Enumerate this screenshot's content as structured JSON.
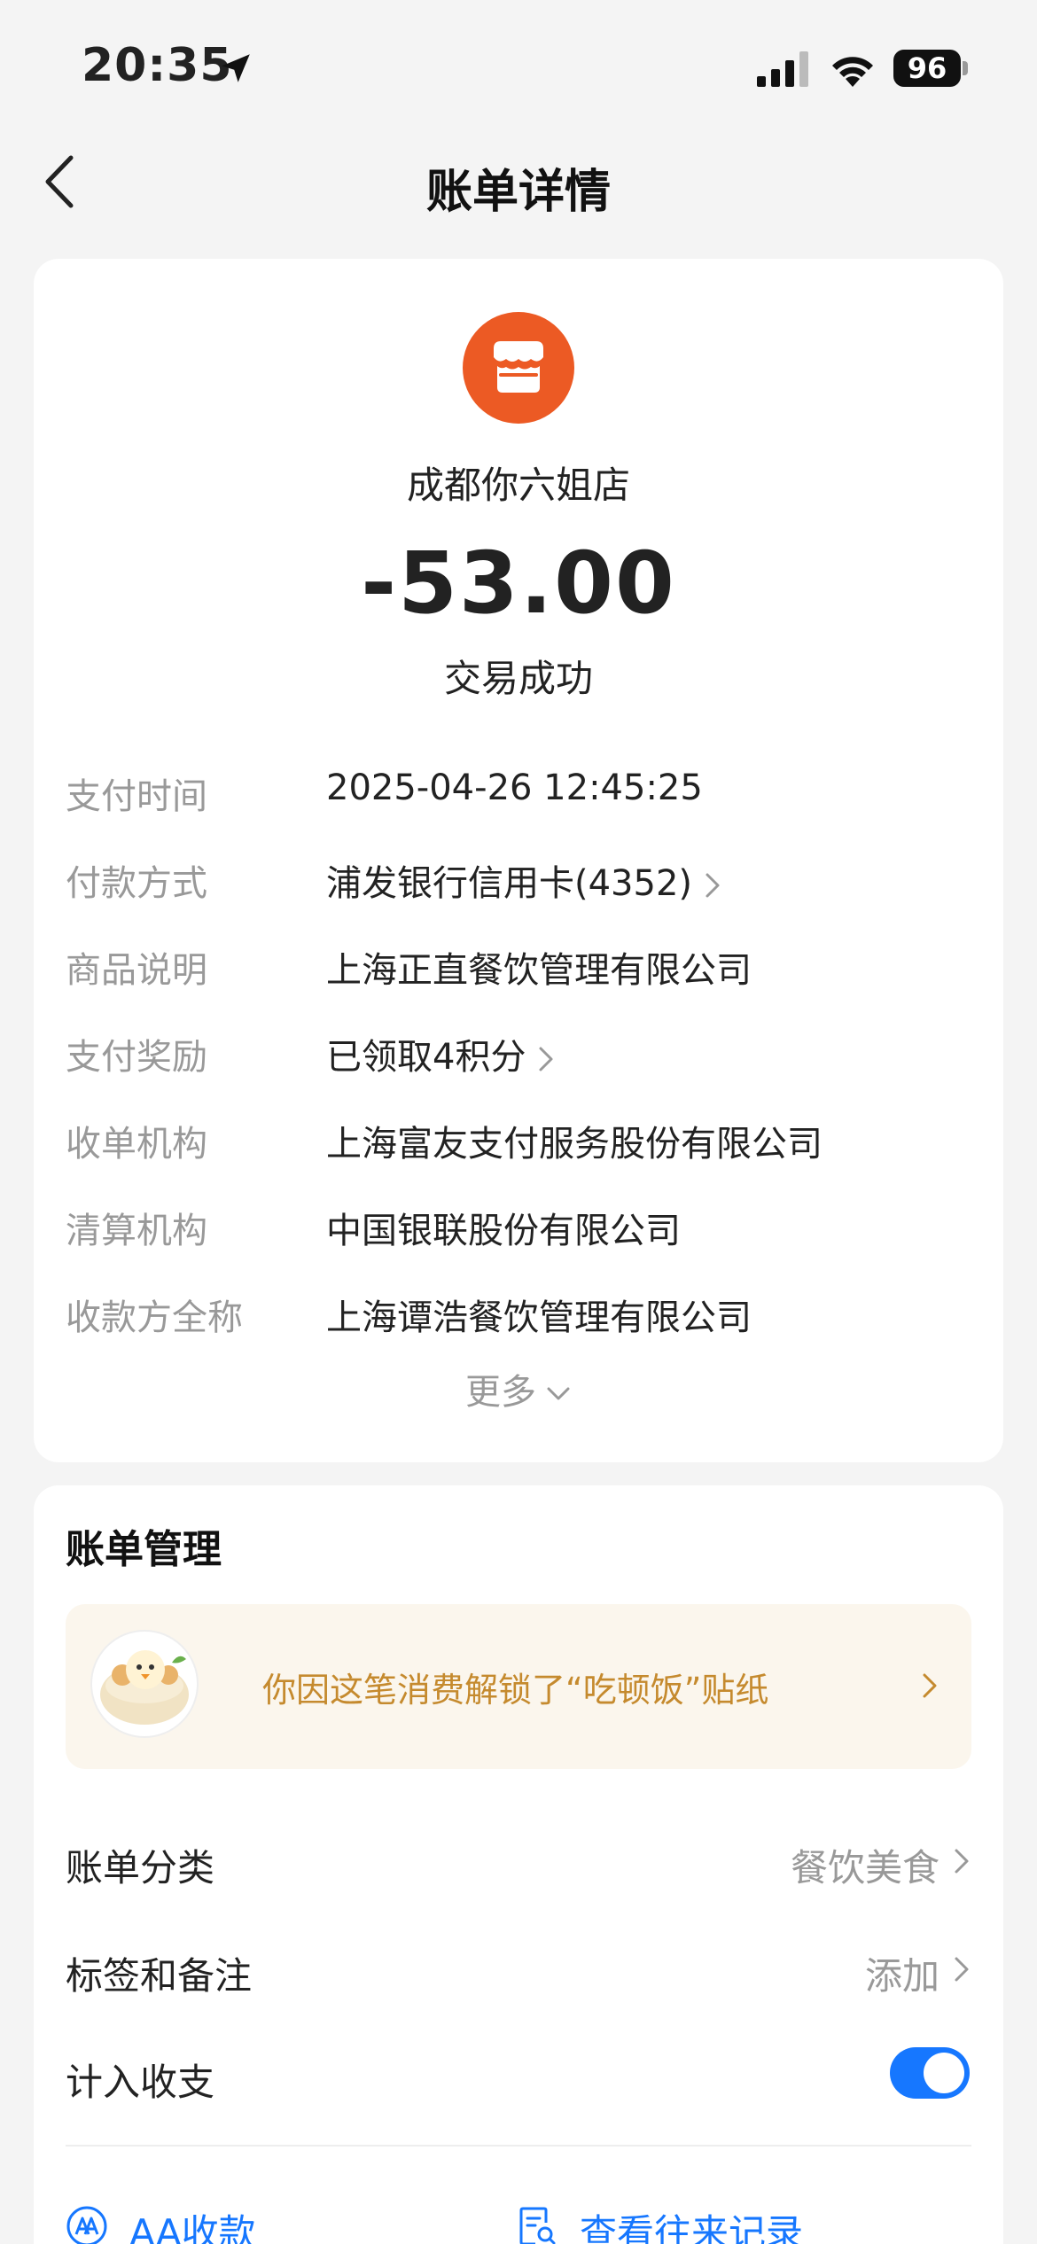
{
  "status_bar": {
    "time": "20:35",
    "battery": "96"
  },
  "nav": {
    "title": "账单详情"
  },
  "transaction": {
    "merchant": "成都你六姐店",
    "amount": "-53.00",
    "status": "交易成功",
    "details": [
      {
        "label": "支付时间",
        "value": "2025-04-26 12:45:25"
      },
      {
        "label": "付款方式",
        "value": "浦发银行信用卡(4352)"
      },
      {
        "label": "商品说明",
        "value": "上海正直餐饮管理有限公司"
      },
      {
        "label": "支付奖励",
        "value": "已领取4积分"
      },
      {
        "label": "收单机构",
        "value": "上海富友支付服务股份有限公司"
      },
      {
        "label": "清算机构",
        "value": "中国银联股份有限公司"
      },
      {
        "label": "收款方全称",
        "value": "上海谭浩餐饮管理有限公司"
      }
    ],
    "more_label": "更多"
  },
  "manage": {
    "title": "账单管理",
    "sticker_text": "你因这笔消费解锁了“吃顿饭”贴纸",
    "category": {
      "label": "账单分类",
      "value": "餐饮美食"
    },
    "tags": {
      "label": "标签和备注",
      "value": "添加"
    },
    "include": {
      "label": "计入收支",
      "enabled": true
    },
    "actions": {
      "aa": "AA收款",
      "history": "查看往来记录"
    }
  },
  "colors": {
    "accent": "#1677ff",
    "merchant_icon": "#ec5a24",
    "sticker_text": "#c58a2e"
  },
  "icons": [
    "location-arrow-icon",
    "signal-icon",
    "wifi-icon",
    "battery-icon",
    "back-icon",
    "store-icon",
    "chevron-right-icon",
    "chevron-down-icon",
    "sticker-icon",
    "aa-icon",
    "history-icon"
  ]
}
